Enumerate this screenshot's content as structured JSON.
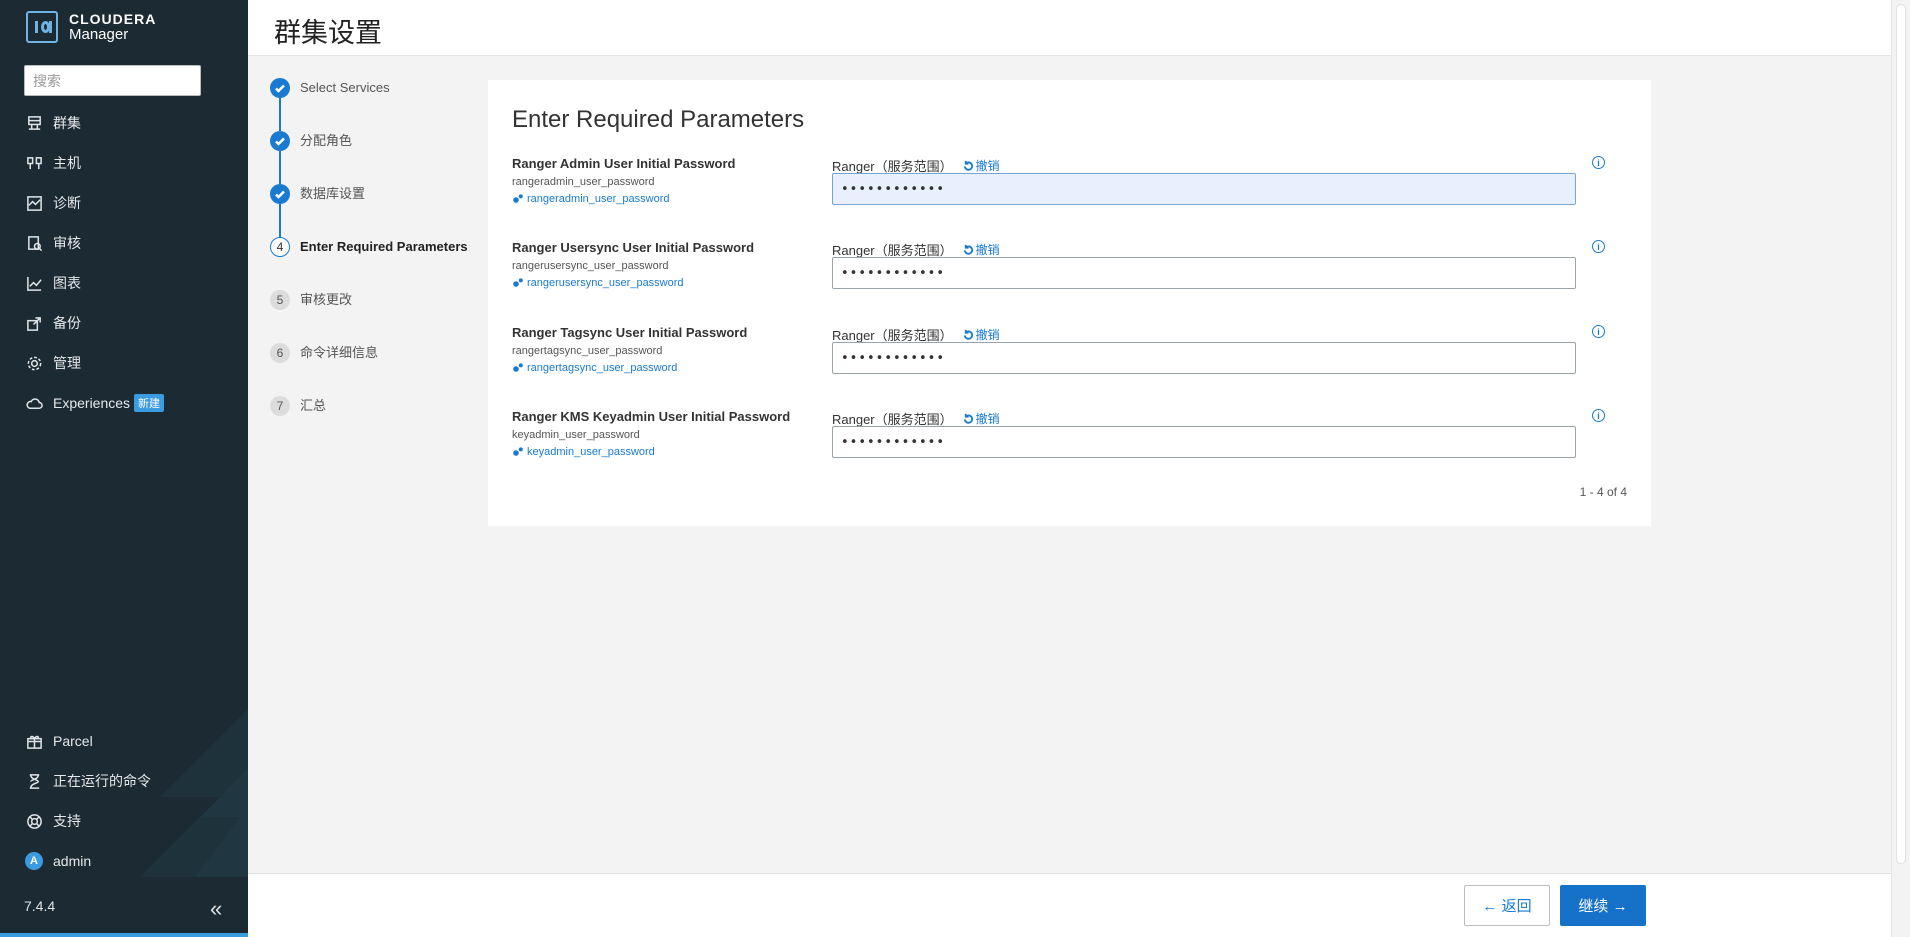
{
  "brand": {
    "name": "CLOUDERA",
    "product": "Manager"
  },
  "search": {
    "placeholder": "搜索"
  },
  "sidebar": {
    "items": [
      {
        "label": "群集",
        "icon": "cluster-icon"
      },
      {
        "label": "主机",
        "icon": "hosts-icon"
      },
      {
        "label": "诊断",
        "icon": "diagnostics-icon"
      },
      {
        "label": "审核",
        "icon": "audit-icon"
      },
      {
        "label": "图表",
        "icon": "charts-icon"
      },
      {
        "label": "备份",
        "icon": "backup-icon"
      },
      {
        "label": "管理",
        "icon": "gear-icon"
      },
      {
        "label": "Experiences",
        "icon": "cloud-icon",
        "badge": "新建"
      }
    ],
    "bottom_items": [
      {
        "label": "Parcel",
        "icon": "gift-icon"
      },
      {
        "label": "正在运行的命令",
        "icon": "hourglass-icon"
      },
      {
        "label": "支持",
        "icon": "lifebuoy-icon"
      },
      {
        "label": "admin",
        "icon": "avatar",
        "avatar_letter": "A"
      }
    ],
    "version": "7.4.4",
    "collapse_label": "«"
  },
  "page": {
    "title": "群集设置"
  },
  "steps": [
    {
      "number": "1",
      "label": "Select Services",
      "state": "done"
    },
    {
      "number": "2",
      "label": "分配角色",
      "state": "done"
    },
    {
      "number": "3",
      "label": "数据库设置",
      "state": "done"
    },
    {
      "number": "4",
      "label": "Enter Required Parameters",
      "state": "active"
    },
    {
      "number": "5",
      "label": "审核更改",
      "state": "todo"
    },
    {
      "number": "6",
      "label": "命令详细信息",
      "state": "todo"
    },
    {
      "number": "7",
      "label": "汇总",
      "state": "todo"
    }
  ],
  "card": {
    "title": "Enter Required Parameters",
    "params": [
      {
        "name": "Ranger Admin User Initial Password",
        "key": "rangeradmin_user_password",
        "link": "rangeradmin_user_password",
        "scope": "Ranger（服务范围）",
        "undo": "撤销",
        "value": "••••••••••••",
        "focused": true
      },
      {
        "name": "Ranger Usersync User Initial Password",
        "key": "rangerusersync_user_password",
        "link": "rangerusersync_user_password",
        "scope": "Ranger（服务范围）",
        "undo": "撤销",
        "value": "••••••••••••",
        "focused": false
      },
      {
        "name": "Ranger Tagsync User Initial Password",
        "key": "rangertagsync_user_password",
        "link": "rangertagsync_user_password",
        "scope": "Ranger（服务范围）",
        "undo": "撤销",
        "value": "••••••••••••",
        "focused": false
      },
      {
        "name": "Ranger KMS Keyadmin User Initial Password",
        "key": "keyadmin_user_password",
        "link": "keyadmin_user_password",
        "scope": "Ranger（服务范围）",
        "undo": "撤销",
        "value": "••••••••••••",
        "focused": false
      }
    ],
    "pager": "1 - 4 of 4"
  },
  "footer": {
    "back_label": "← 返回",
    "next_label": "继续 →"
  },
  "colors": {
    "sidebar_bg": "#1b2a33",
    "accent": "#1a7ad0",
    "primary_button": "#1672c9"
  }
}
